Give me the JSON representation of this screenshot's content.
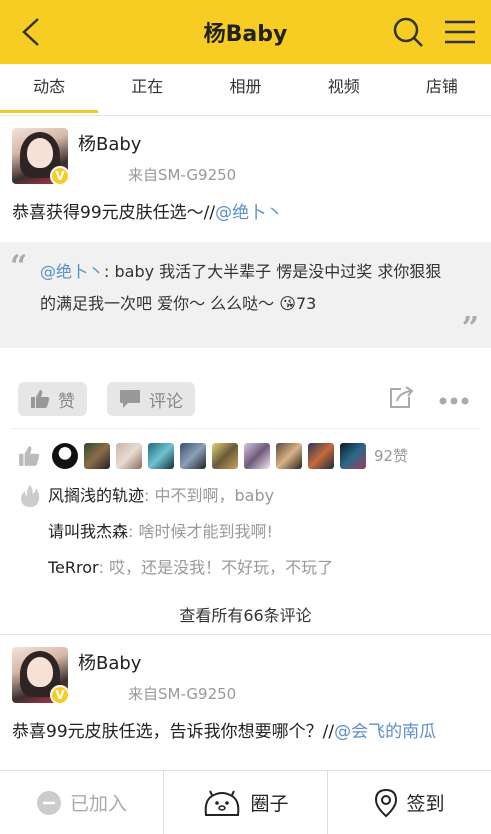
{
  "header": {
    "title": "杨Baby",
    "accent": "#f7cd24"
  },
  "tabs": [
    {
      "label": "动态",
      "active": true
    },
    {
      "label": "正在",
      "active": false
    },
    {
      "label": "相册",
      "active": false
    },
    {
      "label": "视频",
      "active": false
    },
    {
      "label": "店铺",
      "active": false
    }
  ],
  "post1": {
    "author": "杨Baby",
    "source": "来自SM-G9250",
    "text": "恭喜获得99元皮肤任选～//",
    "mention": "@绝卜丶",
    "quote": {
      "mention": "@绝卜丶",
      "text_line1": ": baby  我活了大半辈子 愣是没中过奖  求你狠狠",
      "text_line2": "的满足我一次吧 爱你～ 么么哒～ ",
      "emoji": "😘",
      "count": "73"
    },
    "like_label": "赞",
    "comment_label": "评论",
    "likes_count": "92赞",
    "comments": [
      {
        "author": "风搁浅的轨迹",
        "text": ": 中不到啊，baby"
      },
      {
        "author": "请叫我杰森",
        "text": ": 啥时候才能到我啊!"
      },
      {
        "author": "TeRror",
        "text": ": 哎，还是没我！不好玩，不玩了"
      }
    ],
    "see_all": "查看所有66条评论"
  },
  "post2": {
    "author": "杨Baby",
    "source": "来自SM-G9250",
    "text": "恭喜99元皮肤任选，告诉我你想要哪个？//",
    "mention": "@会飞的南瓜"
  },
  "bottom": {
    "joined": "已加入",
    "circle": "圈子",
    "checkin": "签到"
  }
}
